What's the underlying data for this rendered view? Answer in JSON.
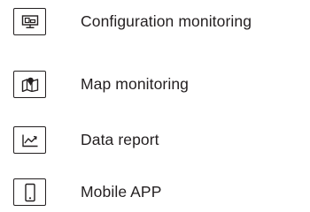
{
  "features": {
    "items": [
      {
        "label": "Configuration monitoring",
        "icon": "monitor-icon"
      },
      {
        "label": "Map monitoring",
        "icon": "map-pin-icon"
      },
      {
        "label": "Data report",
        "icon": "line-chart-icon"
      },
      {
        "label": "Mobile APP",
        "icon": "smartphone-icon"
      }
    ]
  },
  "colors": {
    "text": "#231f20",
    "icon_stroke": "#231f20",
    "background": "#ffffff"
  }
}
